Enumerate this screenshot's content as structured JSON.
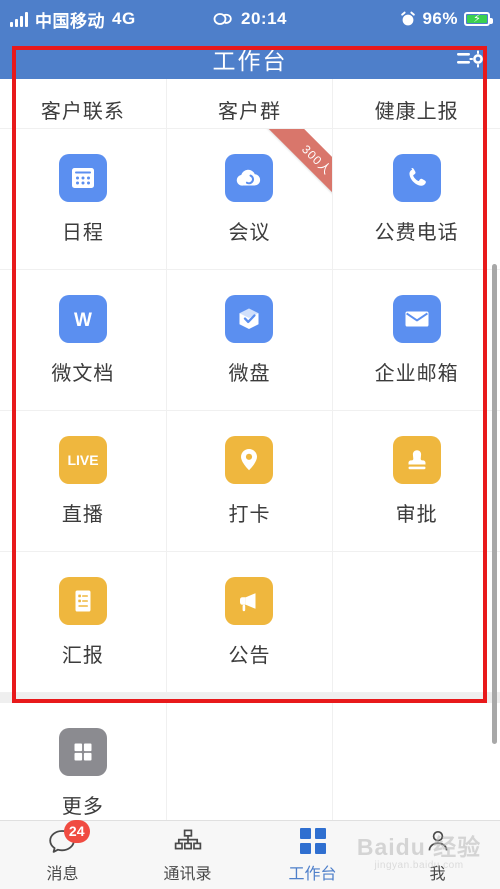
{
  "status_bar": {
    "carrier": "中国移动",
    "network": "4G",
    "time": "20:14",
    "battery_percent": "96%",
    "signal_icon": "signal-bars-icon",
    "link_icon": "link-loop-icon",
    "alarm_icon": "alarm-clock-icon",
    "battery_icon": "battery-charging-icon"
  },
  "header": {
    "title": "工作台",
    "action_icon": "manage-settings-icon"
  },
  "colors": {
    "brand_blue": "#4e7fca",
    "icon_blue": "#5b8ff0",
    "icon_yellow": "#efb73e",
    "icon_gray": "#8b8b90",
    "ribbon_red": "#d9766b",
    "annotation_red": "#e8191b",
    "badge_red": "#f04b41",
    "active_tab": "#4e7fca"
  },
  "workbench": {
    "clipped_row": [
      {
        "label": "客户联系",
        "icon": "customer-contact-icon"
      },
      {
        "label": "客户群",
        "icon": "customer-group-icon"
      },
      {
        "label": "健康上报",
        "icon": "health-report-icon"
      }
    ],
    "apps": [
      {
        "label": "日程",
        "icon": "calendar-icon",
        "color": "blue",
        "ribbon": ""
      },
      {
        "label": "会议",
        "icon": "cloud-meeting-icon",
        "color": "blue",
        "ribbon": "300人"
      },
      {
        "label": "公费电话",
        "icon": "phone-icon",
        "color": "blue",
        "ribbon": ""
      },
      {
        "label": "微文档",
        "icon": "document-w-icon",
        "color": "blue",
        "ribbon": ""
      },
      {
        "label": "微盘",
        "icon": "cloud-drive-box-icon",
        "color": "blue",
        "ribbon": ""
      },
      {
        "label": "企业邮箱",
        "icon": "mail-envelope-icon",
        "color": "blue",
        "ribbon": ""
      },
      {
        "label": "直播",
        "icon": "live-icon",
        "color": "yellow",
        "ribbon": ""
      },
      {
        "label": "打卡",
        "icon": "location-pin-icon",
        "color": "yellow",
        "ribbon": ""
      },
      {
        "label": "审批",
        "icon": "approval-stamp-icon",
        "color": "yellow",
        "ribbon": ""
      },
      {
        "label": "汇报",
        "icon": "report-doc-icon",
        "color": "yellow",
        "ribbon": ""
      },
      {
        "label": "公告",
        "icon": "megaphone-icon",
        "color": "yellow",
        "ribbon": ""
      }
    ],
    "more": {
      "label": "更多",
      "icon": "more-grid-icon",
      "color": "gray"
    }
  },
  "tabbar": [
    {
      "label": "消息",
      "icon": "chat-bubble-icon",
      "badge": "24",
      "active": false
    },
    {
      "label": "通讯录",
      "icon": "org-chart-icon",
      "badge": "",
      "active": false
    },
    {
      "label": "工作台",
      "icon": "workbench-grid-icon",
      "badge": "",
      "active": true
    },
    {
      "label": "我",
      "icon": "profile-people-icon",
      "badge": "",
      "active": false
    }
  ],
  "watermark": {
    "main": "Baidu 经验",
    "sub": "jingyan.baidu.com"
  }
}
